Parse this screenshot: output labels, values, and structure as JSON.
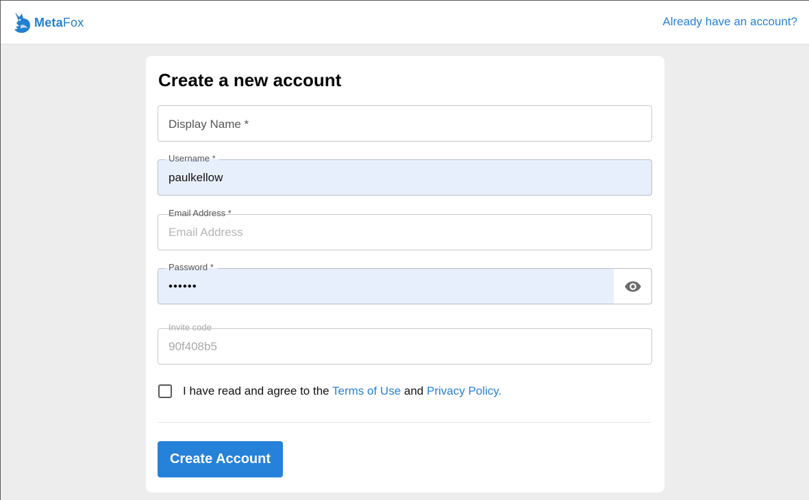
{
  "header": {
    "brand": {
      "part1": "Meta",
      "part2": "Fox"
    },
    "signin_link": "Already have an account?"
  },
  "form": {
    "title": "Create a new account",
    "display_name": {
      "label": "Display Name *",
      "value": ""
    },
    "username": {
      "label": "Username *",
      "value": "paulkellow"
    },
    "email": {
      "label": "Email Address *",
      "placeholder": "Email Address",
      "value": ""
    },
    "password": {
      "label": "Password *",
      "masked_value": "••••••"
    },
    "invite_code": {
      "label": "Invite code",
      "value": "90f408b5"
    },
    "agree": {
      "prefix": "I have read and agree to the ",
      "terms": "Terms of Use",
      "middle": " and ",
      "privacy": "Privacy Policy.",
      "checked": false
    },
    "submit_label": "Create Account"
  },
  "colors": {
    "accent": "#2681d8",
    "autofill_bg": "#e8effc",
    "page_bg": "#ededed"
  },
  "icons": {
    "logo": "fox-logo-icon",
    "password_toggle": "eye-icon"
  }
}
